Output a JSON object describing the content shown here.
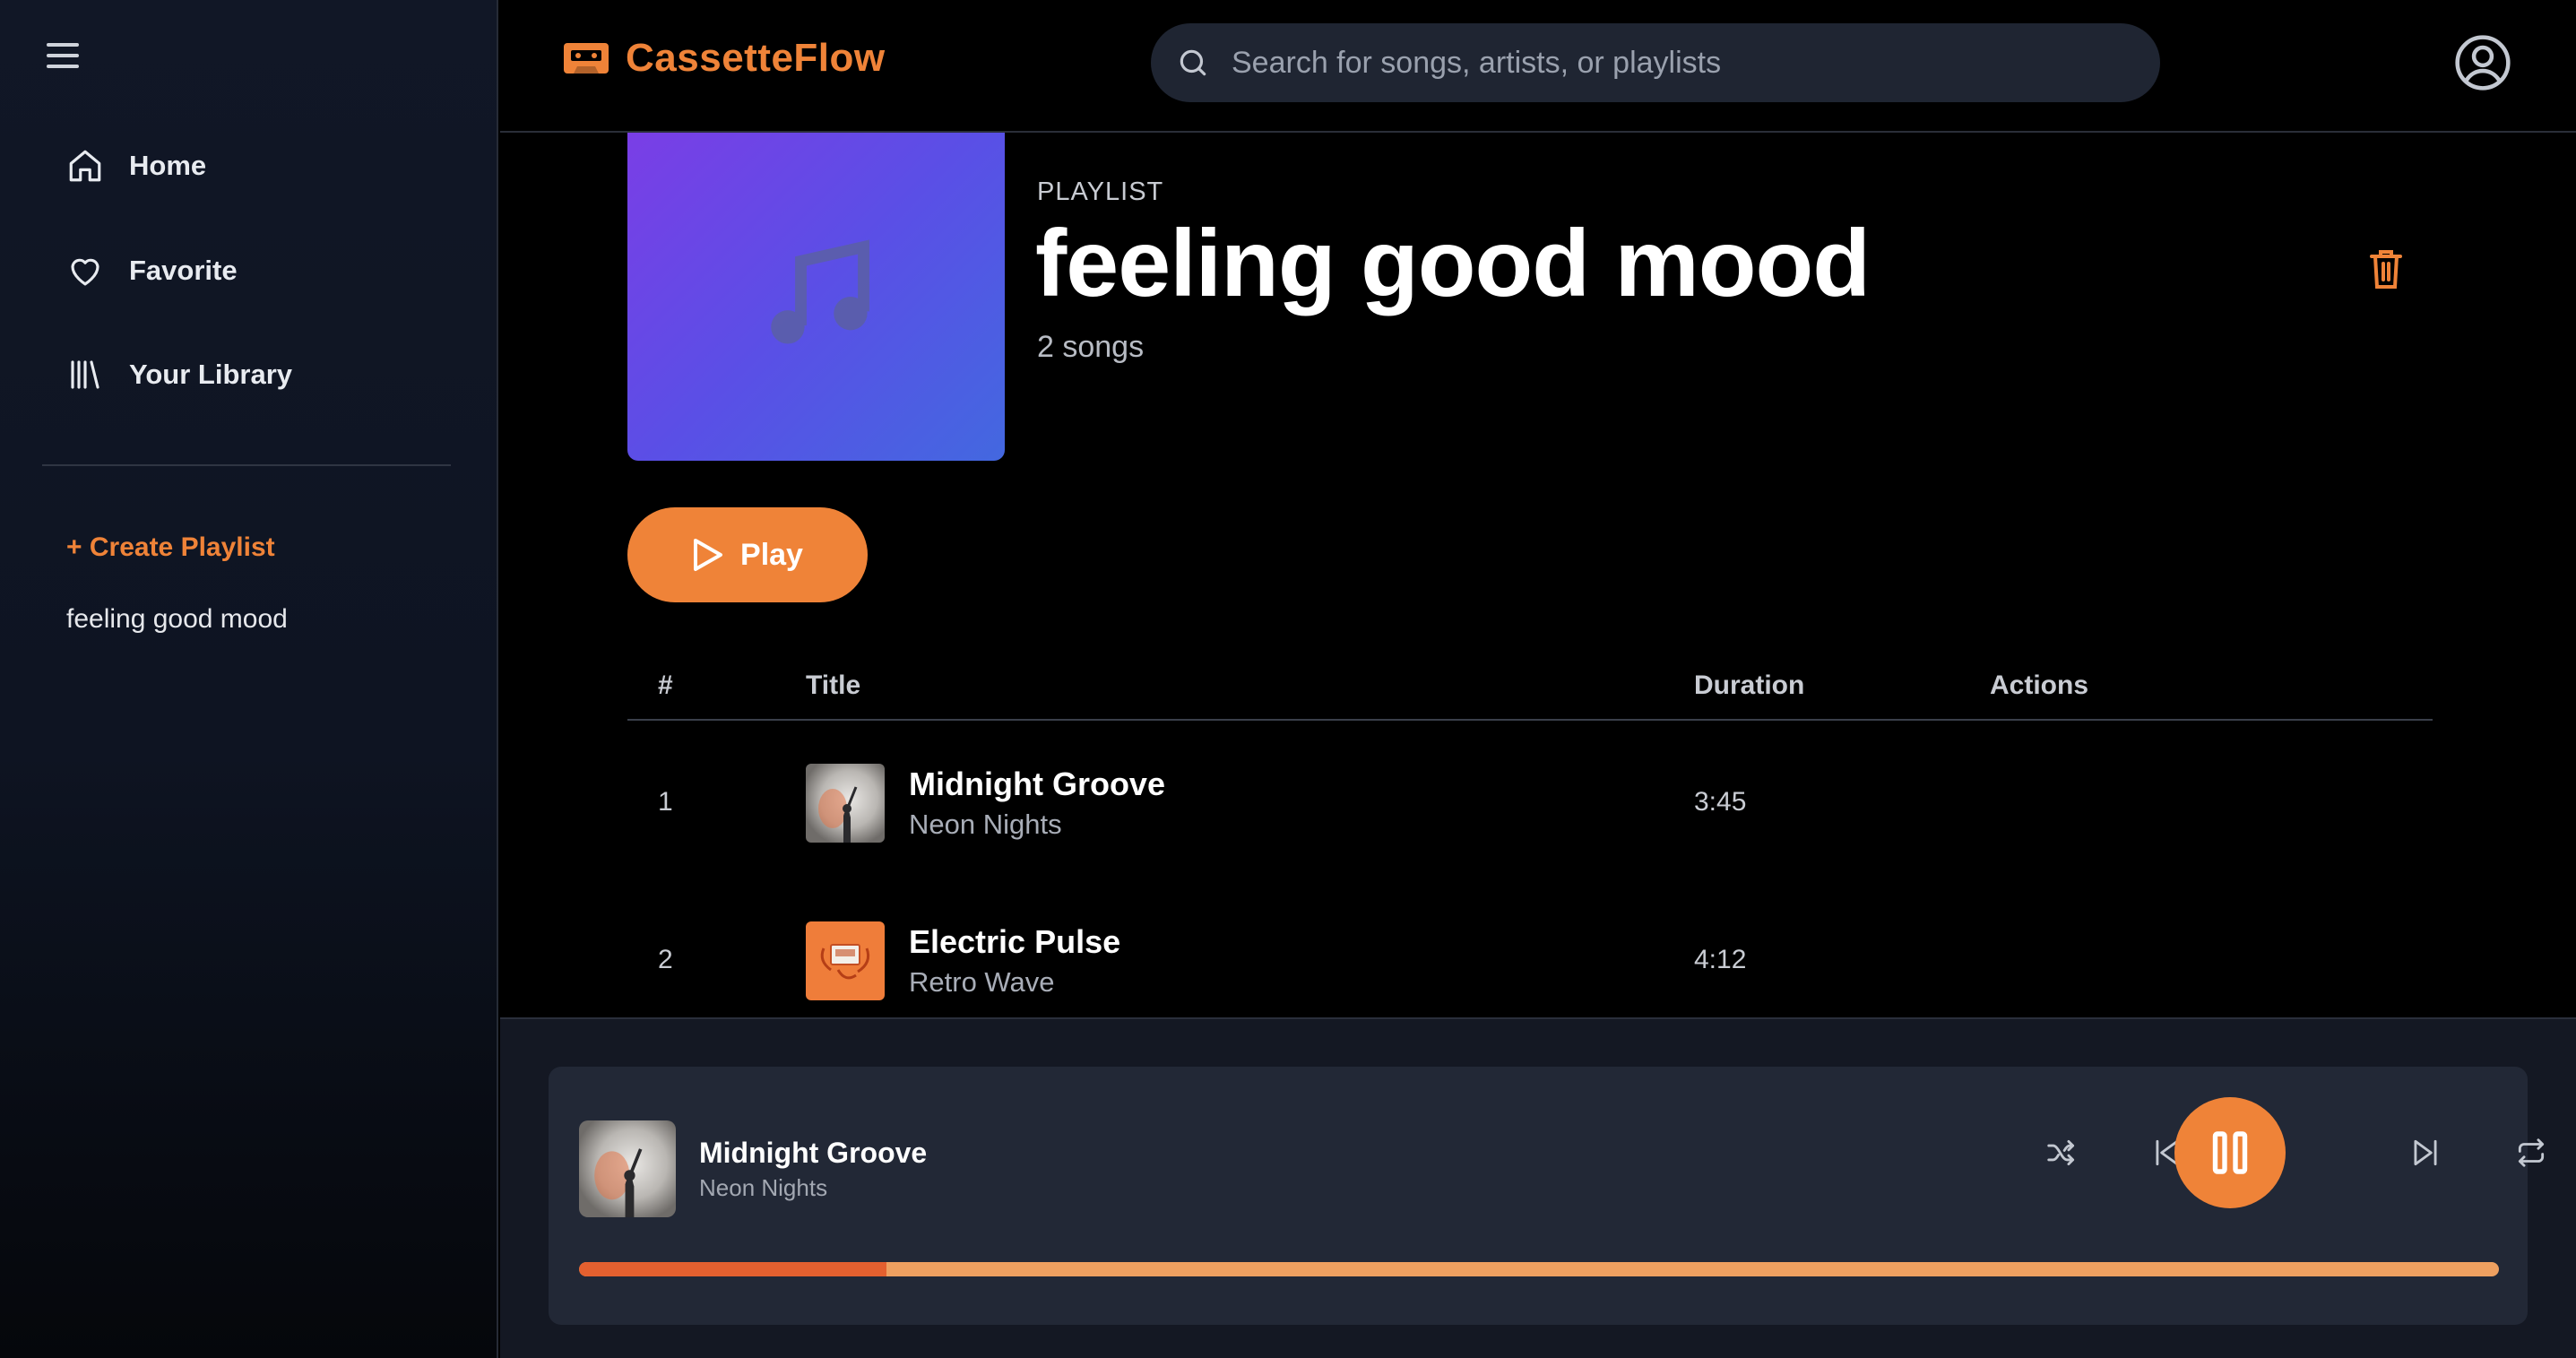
{
  "app": {
    "name": "CassetteFlow"
  },
  "colors": {
    "accent": "#ef8338",
    "sidebar_bg": "#111726",
    "player_bg": "#222836"
  },
  "search": {
    "placeholder": "Search for songs, artists, or playlists"
  },
  "sidebar": {
    "nav": [
      {
        "label": "Home",
        "icon": "home-icon"
      },
      {
        "label": "Favorite",
        "icon": "heart-icon"
      },
      {
        "label": "Your Library",
        "icon": "library-icon"
      }
    ],
    "create_playlist": "+ Create Playlist",
    "playlists": [
      "feeling good mood"
    ]
  },
  "playlist": {
    "kind": "PLAYLIST",
    "title": "feeling good mood",
    "count": "2 songs",
    "play_label": "Play"
  },
  "table": {
    "headers": {
      "num": "#",
      "title": "Title",
      "duration": "Duration",
      "actions": "Actions"
    },
    "rows": [
      {
        "num": "1",
        "title": "Midnight Groove",
        "artist": "Neon Nights",
        "duration": "3:45"
      },
      {
        "num": "2",
        "title": "Electric Pulse",
        "artist": "Retro Wave",
        "duration": "4:12"
      }
    ]
  },
  "now_playing": {
    "title": "Midnight Groove",
    "artist": "Neon Nights",
    "progress": 0.16
  }
}
